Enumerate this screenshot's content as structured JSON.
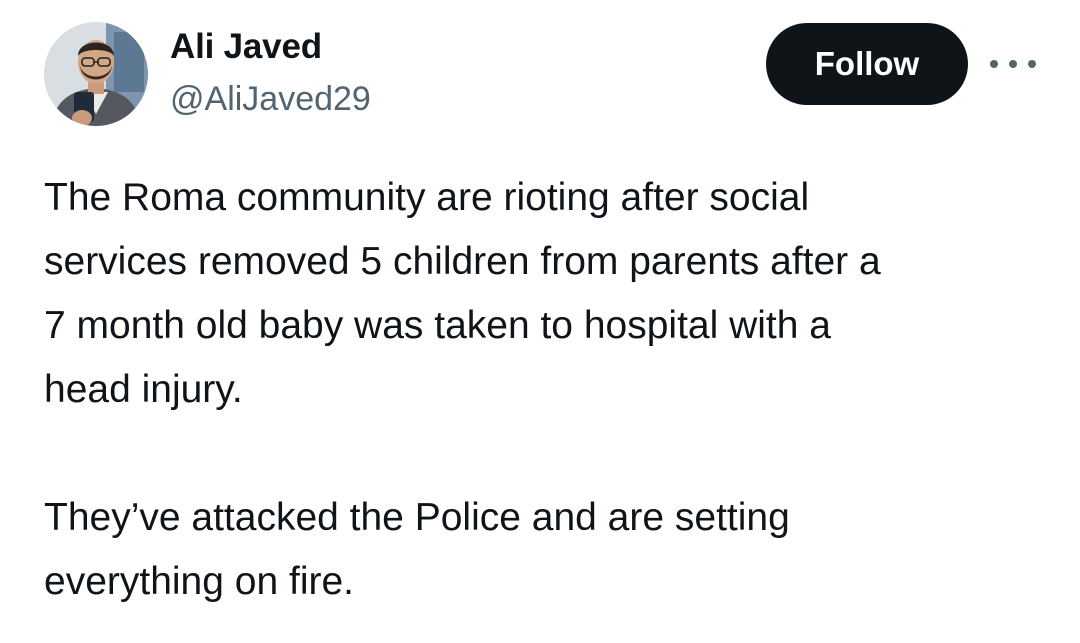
{
  "author": {
    "display_name": "Ali Javed",
    "handle": "@AliJaved29",
    "avatar_icon": "profile-photo"
  },
  "actions": {
    "follow_label": "Follow",
    "more_icon": "more-horizontal-icon"
  },
  "tweet": {
    "paragraphs": [
      "The Roma community are rioting after social\nservices removed 5 children from parents after a\n7 month old baby was taken to hospital with a\nhead injury.",
      "They’ve attacked the Police and are setting\neverything on fire."
    ]
  },
  "colors": {
    "text_primary": "#0f1419",
    "text_secondary": "#536471",
    "follow_bg": "#0f1419",
    "follow_text": "#ffffff"
  }
}
